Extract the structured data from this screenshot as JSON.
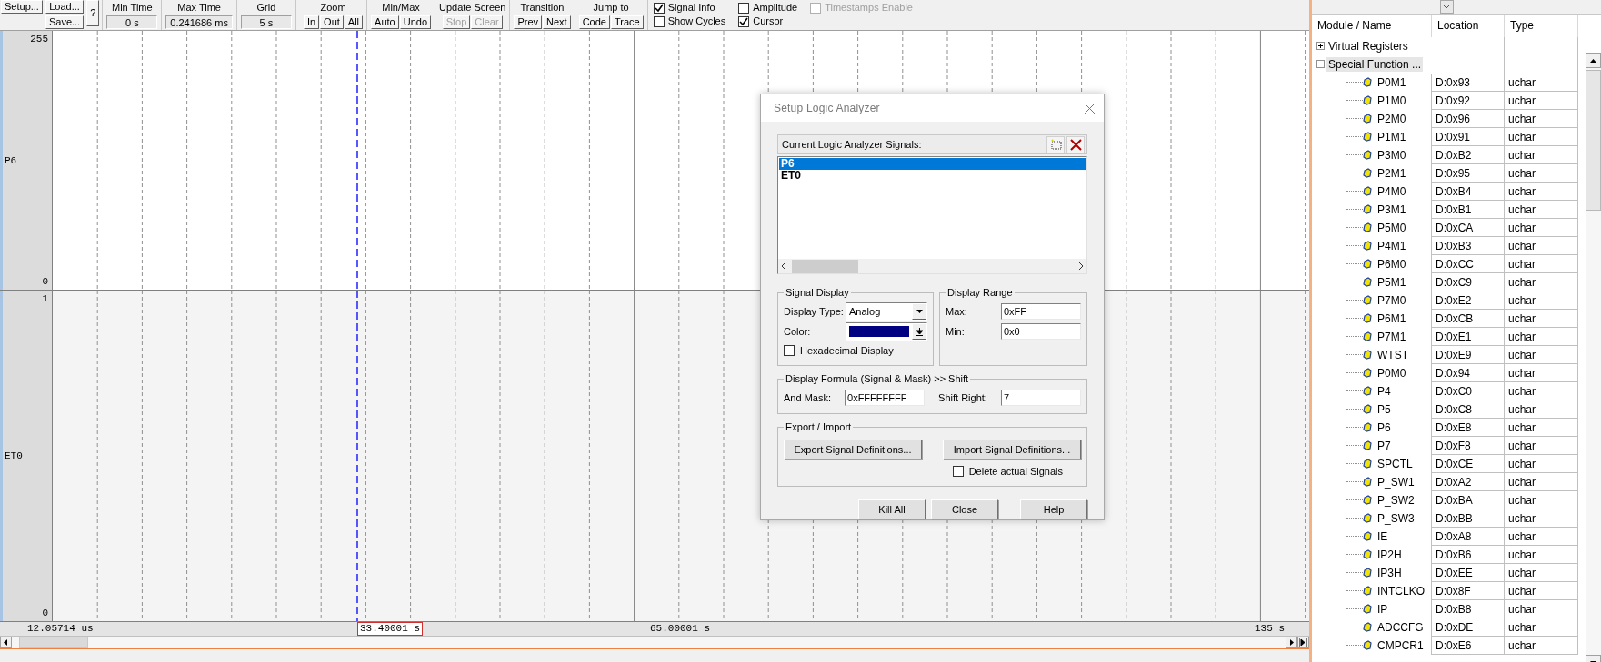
{
  "toolbar": {
    "setup_button": "Setup...",
    "load_button": "Load...",
    "save_button": "Save...",
    "help_button": "?",
    "readouts": [
      {
        "label": "Min Time",
        "value": "0 s"
      },
      {
        "label": "Max Time",
        "value": "0.241686 ms"
      },
      {
        "label": "Grid",
        "value": "5 s"
      }
    ],
    "groups": [
      {
        "label": "Zoom",
        "buttons": [
          {
            "label": "In",
            "disabled": false
          },
          {
            "label": "Out",
            "disabled": false
          },
          {
            "label": "All",
            "disabled": false
          }
        ]
      },
      {
        "label": "Min/Max",
        "buttons": [
          {
            "label": "Auto",
            "disabled": false
          },
          {
            "label": "Undo",
            "disabled": false
          }
        ]
      },
      {
        "label": "Update Screen",
        "buttons": [
          {
            "label": "Stop",
            "disabled": true
          },
          {
            "label": "Clear",
            "disabled": true
          }
        ]
      },
      {
        "label": "Transition",
        "buttons": [
          {
            "label": "Prev",
            "disabled": false
          },
          {
            "label": "Next",
            "disabled": false
          }
        ]
      },
      {
        "label": "Jump to",
        "buttons": [
          {
            "label": "Code",
            "disabled": false
          },
          {
            "label": "Trace",
            "disabled": false
          }
        ]
      }
    ],
    "options": [
      {
        "label": "Signal Info",
        "checked": true,
        "disabled": false
      },
      {
        "label": "Amplitude",
        "checked": false,
        "disabled": false
      },
      {
        "label": "Timestamps Enable",
        "checked": false,
        "disabled": true
      },
      {
        "label": "Show Cycles",
        "checked": false,
        "disabled": false
      },
      {
        "label": "Cursor",
        "checked": true,
        "disabled": false
      }
    ]
  },
  "signals": [
    {
      "name": "P6",
      "max": "255",
      "min": "0"
    },
    {
      "name": "ET0",
      "max": "1",
      "min": "0"
    }
  ],
  "time_axis": {
    "start": "12.05714 us",
    "cursor": "33.40001 s",
    "middle": "65.00001 s",
    "end": "135 s"
  },
  "dialog": {
    "title": "Setup Logic Analyzer",
    "signals_label": "Current Logic Analyzer Signals:",
    "signals": [
      {
        "name": "P6",
        "selected": true
      },
      {
        "name": "ET0",
        "selected": false
      }
    ],
    "signal_display": {
      "title": "Signal Display",
      "type_label": "Display Type:",
      "type": "Analog",
      "color_label": "Color:",
      "color": "#000080",
      "hex_label": "Hexadecimal Display",
      "hex_checked": false
    },
    "display_range": {
      "title": "Display Range",
      "max_label": "Max:",
      "max": "0xFF",
      "min_label": "Min:",
      "min": "0x0"
    },
    "formula": {
      "title": "Display Formula (Signal & Mask) >> Shift",
      "mask_label": "And Mask:",
      "mask": "0xFFFFFFFF",
      "shift_label": "Shift Right:",
      "shift": "7"
    },
    "export": {
      "title": "Export / Import",
      "export_button": "Export Signal Definitions...",
      "import_button": "Import Signal Definitions...",
      "delete_label": "Delete actual Signals",
      "delete_checked": false
    },
    "buttons": [
      "Kill All",
      "Close",
      "Help"
    ]
  },
  "symbols": {
    "columns": [
      "Module / Name",
      "Location",
      "Type"
    ],
    "tree": [
      {
        "name": "Virtual Registers",
        "expanded": false,
        "selected": false
      },
      {
        "name": "Special Function ...",
        "expanded": true,
        "selected": true,
        "children": [
          {
            "name": "P0M1",
            "location": "D:0x93",
            "type": "uchar"
          },
          {
            "name": "P1M0",
            "location": "D:0x92",
            "type": "uchar"
          },
          {
            "name": "P2M0",
            "location": "D:0x96",
            "type": "uchar"
          },
          {
            "name": "P1M1",
            "location": "D:0x91",
            "type": "uchar"
          },
          {
            "name": "P3M0",
            "location": "D:0xB2",
            "type": "uchar"
          },
          {
            "name": "P2M1",
            "location": "D:0x95",
            "type": "uchar"
          },
          {
            "name": "P4M0",
            "location": "D:0xB4",
            "type": "uchar"
          },
          {
            "name": "P3M1",
            "location": "D:0xB1",
            "type": "uchar"
          },
          {
            "name": "P5M0",
            "location": "D:0xCA",
            "type": "uchar"
          },
          {
            "name": "P4M1",
            "location": "D:0xB3",
            "type": "uchar"
          },
          {
            "name": "P6M0",
            "location": "D:0xCC",
            "type": "uchar"
          },
          {
            "name": "P5M1",
            "location": "D:0xC9",
            "type": "uchar"
          },
          {
            "name": "P7M0",
            "location": "D:0xE2",
            "type": "uchar"
          },
          {
            "name": "P6M1",
            "location": "D:0xCB",
            "type": "uchar"
          },
          {
            "name": "P7M1",
            "location": "D:0xE1",
            "type": "uchar"
          },
          {
            "name": "WTST",
            "location": "D:0xE9",
            "type": "uchar"
          },
          {
            "name": "P0M0",
            "location": "D:0x94",
            "type": "uchar"
          },
          {
            "name": "P4",
            "location": "D:0xC0",
            "type": "uchar"
          },
          {
            "name": "P5",
            "location": "D:0xC8",
            "type": "uchar"
          },
          {
            "name": "P6",
            "location": "D:0xE8",
            "type": "uchar"
          },
          {
            "name": "P7",
            "location": "D:0xF8",
            "type": "uchar"
          },
          {
            "name": "SPCTL",
            "location": "D:0xCE",
            "type": "uchar"
          },
          {
            "name": "P_SW1",
            "location": "D:0xA2",
            "type": "uchar"
          },
          {
            "name": "P_SW2",
            "location": "D:0xBA",
            "type": "uchar"
          },
          {
            "name": "P_SW3",
            "location": "D:0xBB",
            "type": "uchar"
          },
          {
            "name": "IE",
            "location": "D:0xA8",
            "type": "uchar"
          },
          {
            "name": "IP2H",
            "location": "D:0xB6",
            "type": "uchar"
          },
          {
            "name": "IP3H",
            "location": "D:0xEE",
            "type": "uchar"
          },
          {
            "name": "INTCLKO",
            "location": "D:0x8F",
            "type": "uchar"
          },
          {
            "name": "IP",
            "location": "D:0xB8",
            "type": "uchar"
          },
          {
            "name": "ADCCFG",
            "location": "D:0xDE",
            "type": "uchar"
          },
          {
            "name": "CMPCR1",
            "location": "D:0xE6",
            "type": "uchar"
          }
        ]
      }
    ]
  }
}
